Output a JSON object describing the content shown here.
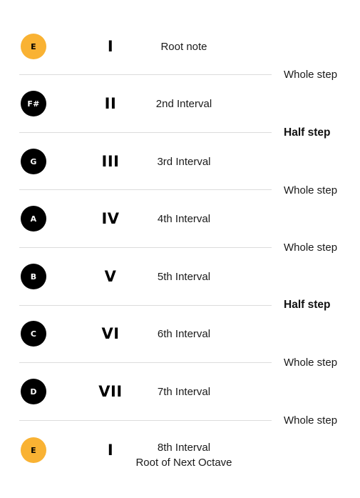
{
  "scale": {
    "colors": {
      "root_note": "#f9b233",
      "scale_note": "#000000",
      "divider": "#dcdcdc"
    },
    "degrees": [
      {
        "note": "E",
        "numeral": "I",
        "interval": "Root note",
        "sub": "",
        "is_root": true
      },
      {
        "note": "F#",
        "numeral": "II",
        "interval": "2nd Interval",
        "sub": "",
        "is_root": false
      },
      {
        "note": "G",
        "numeral": "III",
        "interval": "3rd Interval",
        "sub": "",
        "is_root": false
      },
      {
        "note": "A",
        "numeral": "IV",
        "interval": "4th Interval",
        "sub": "",
        "is_root": false
      },
      {
        "note": "B",
        "numeral": "V",
        "interval": "5th Interval",
        "sub": "",
        "is_root": false
      },
      {
        "note": "C",
        "numeral": "VI",
        "interval": "6th Interval",
        "sub": "",
        "is_root": false
      },
      {
        "note": "D",
        "numeral": "VII",
        "interval": "7th Interval",
        "sub": "",
        "is_root": false
      },
      {
        "note": "E",
        "numeral": "I",
        "interval": "8th Interval",
        "sub": "Root of Next Octave",
        "is_root": true
      }
    ],
    "steps": [
      {
        "label": "Whole step",
        "type": "whole"
      },
      {
        "label": "Half step",
        "type": "half"
      },
      {
        "label": "Whole step",
        "type": "whole"
      },
      {
        "label": "Whole step",
        "type": "whole"
      },
      {
        "label": "Half step",
        "type": "half"
      },
      {
        "label": "Whole step",
        "type": "whole"
      },
      {
        "label": "Whole step",
        "type": "whole"
      }
    ]
  }
}
